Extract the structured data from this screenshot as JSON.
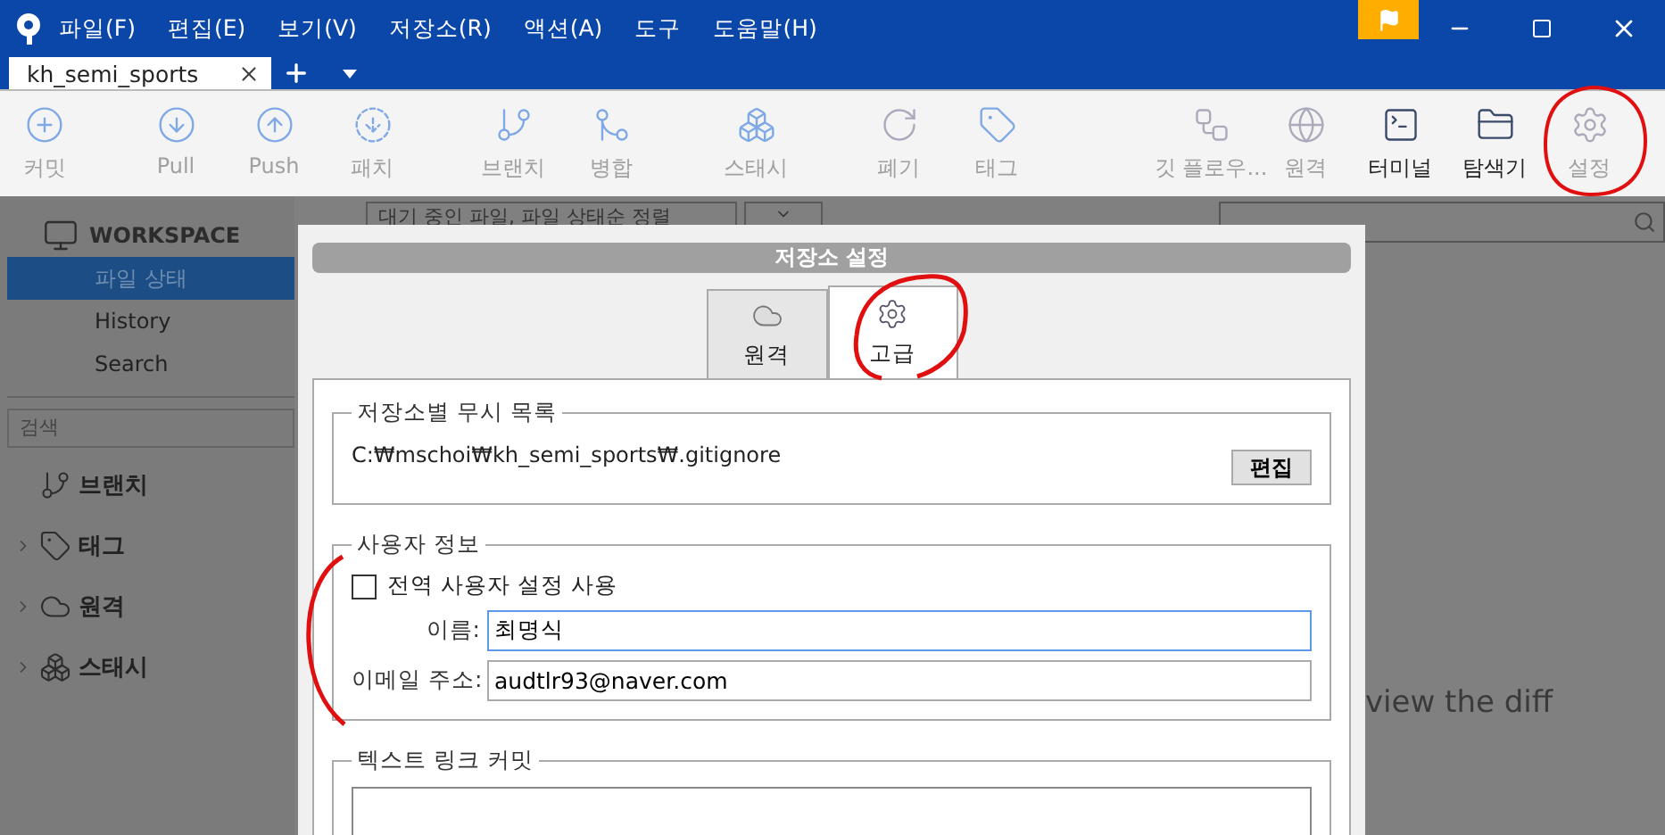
{
  "menu": [
    "파일(F)",
    "편집(E)",
    "보기(V)",
    "저장소(R)",
    "액션(A)",
    "도구",
    "도움말(H)"
  ],
  "repo_tabs": [
    {
      "label": "kh_semi_sports",
      "selected": true
    }
  ],
  "toolbar": [
    {
      "label": "커밋",
      "disabled": true
    },
    {
      "label": "Pull",
      "disabled": true
    },
    {
      "label": "Push",
      "disabled": true
    },
    {
      "label": "패치",
      "disabled": true
    },
    {
      "label": "브랜치",
      "disabled": true
    },
    {
      "label": "병합",
      "disabled": true
    },
    {
      "label": "스태시",
      "disabled": true
    },
    {
      "label": "폐기",
      "disabled": true
    },
    {
      "label": "태그",
      "disabled": true
    },
    {
      "label": "깃 플로우...",
      "disabled": true
    },
    {
      "label": "원격",
      "disabled": true
    },
    {
      "label": "터미널",
      "disabled": false
    },
    {
      "label": "탐색기",
      "disabled": false
    },
    {
      "label": "설정",
      "disabled": true
    }
  ],
  "sidebar": {
    "header": "WORKSPACE",
    "items": [
      {
        "label": "파일 상태",
        "selected": true
      },
      {
        "label": "History",
        "selected": false
      },
      {
        "label": "Search",
        "selected": false
      }
    ],
    "search": {
      "placeholder": "검색"
    },
    "groups": [
      {
        "label": "브랜치",
        "expandable": false
      },
      {
        "label": "태그",
        "expandable": true
      },
      {
        "label": "원격",
        "expandable": true
      },
      {
        "label": "스태시",
        "expandable": true
      }
    ]
  },
  "main": {
    "filter": "대기 중인 파일, 파일 상태순 정렬",
    "hint": "view the diff"
  },
  "dialog": {
    "title": "저장소 설정",
    "tabs": [
      {
        "label": "원격",
        "selected": false
      },
      {
        "label": "고급",
        "selected": true
      }
    ],
    "ignore_group": {
      "title": "저장소별 무시 목록",
      "path": "C:₩mschoi₩kh_semi_sports₩.gitignore",
      "button": "편집"
    },
    "user_group": {
      "title": "사용자 정보",
      "use_global": {
        "label": "전역 사용자 설정 사용",
        "checked": false
      },
      "fields": [
        {
          "label": "이름:",
          "value": "최명식",
          "focused": true
        },
        {
          "label": "이메일 주소:",
          "value": "audtlr93@naver.com",
          "focused": false
        }
      ]
    },
    "link_group": {
      "title": "텍스트 링크 커밋"
    }
  }
}
